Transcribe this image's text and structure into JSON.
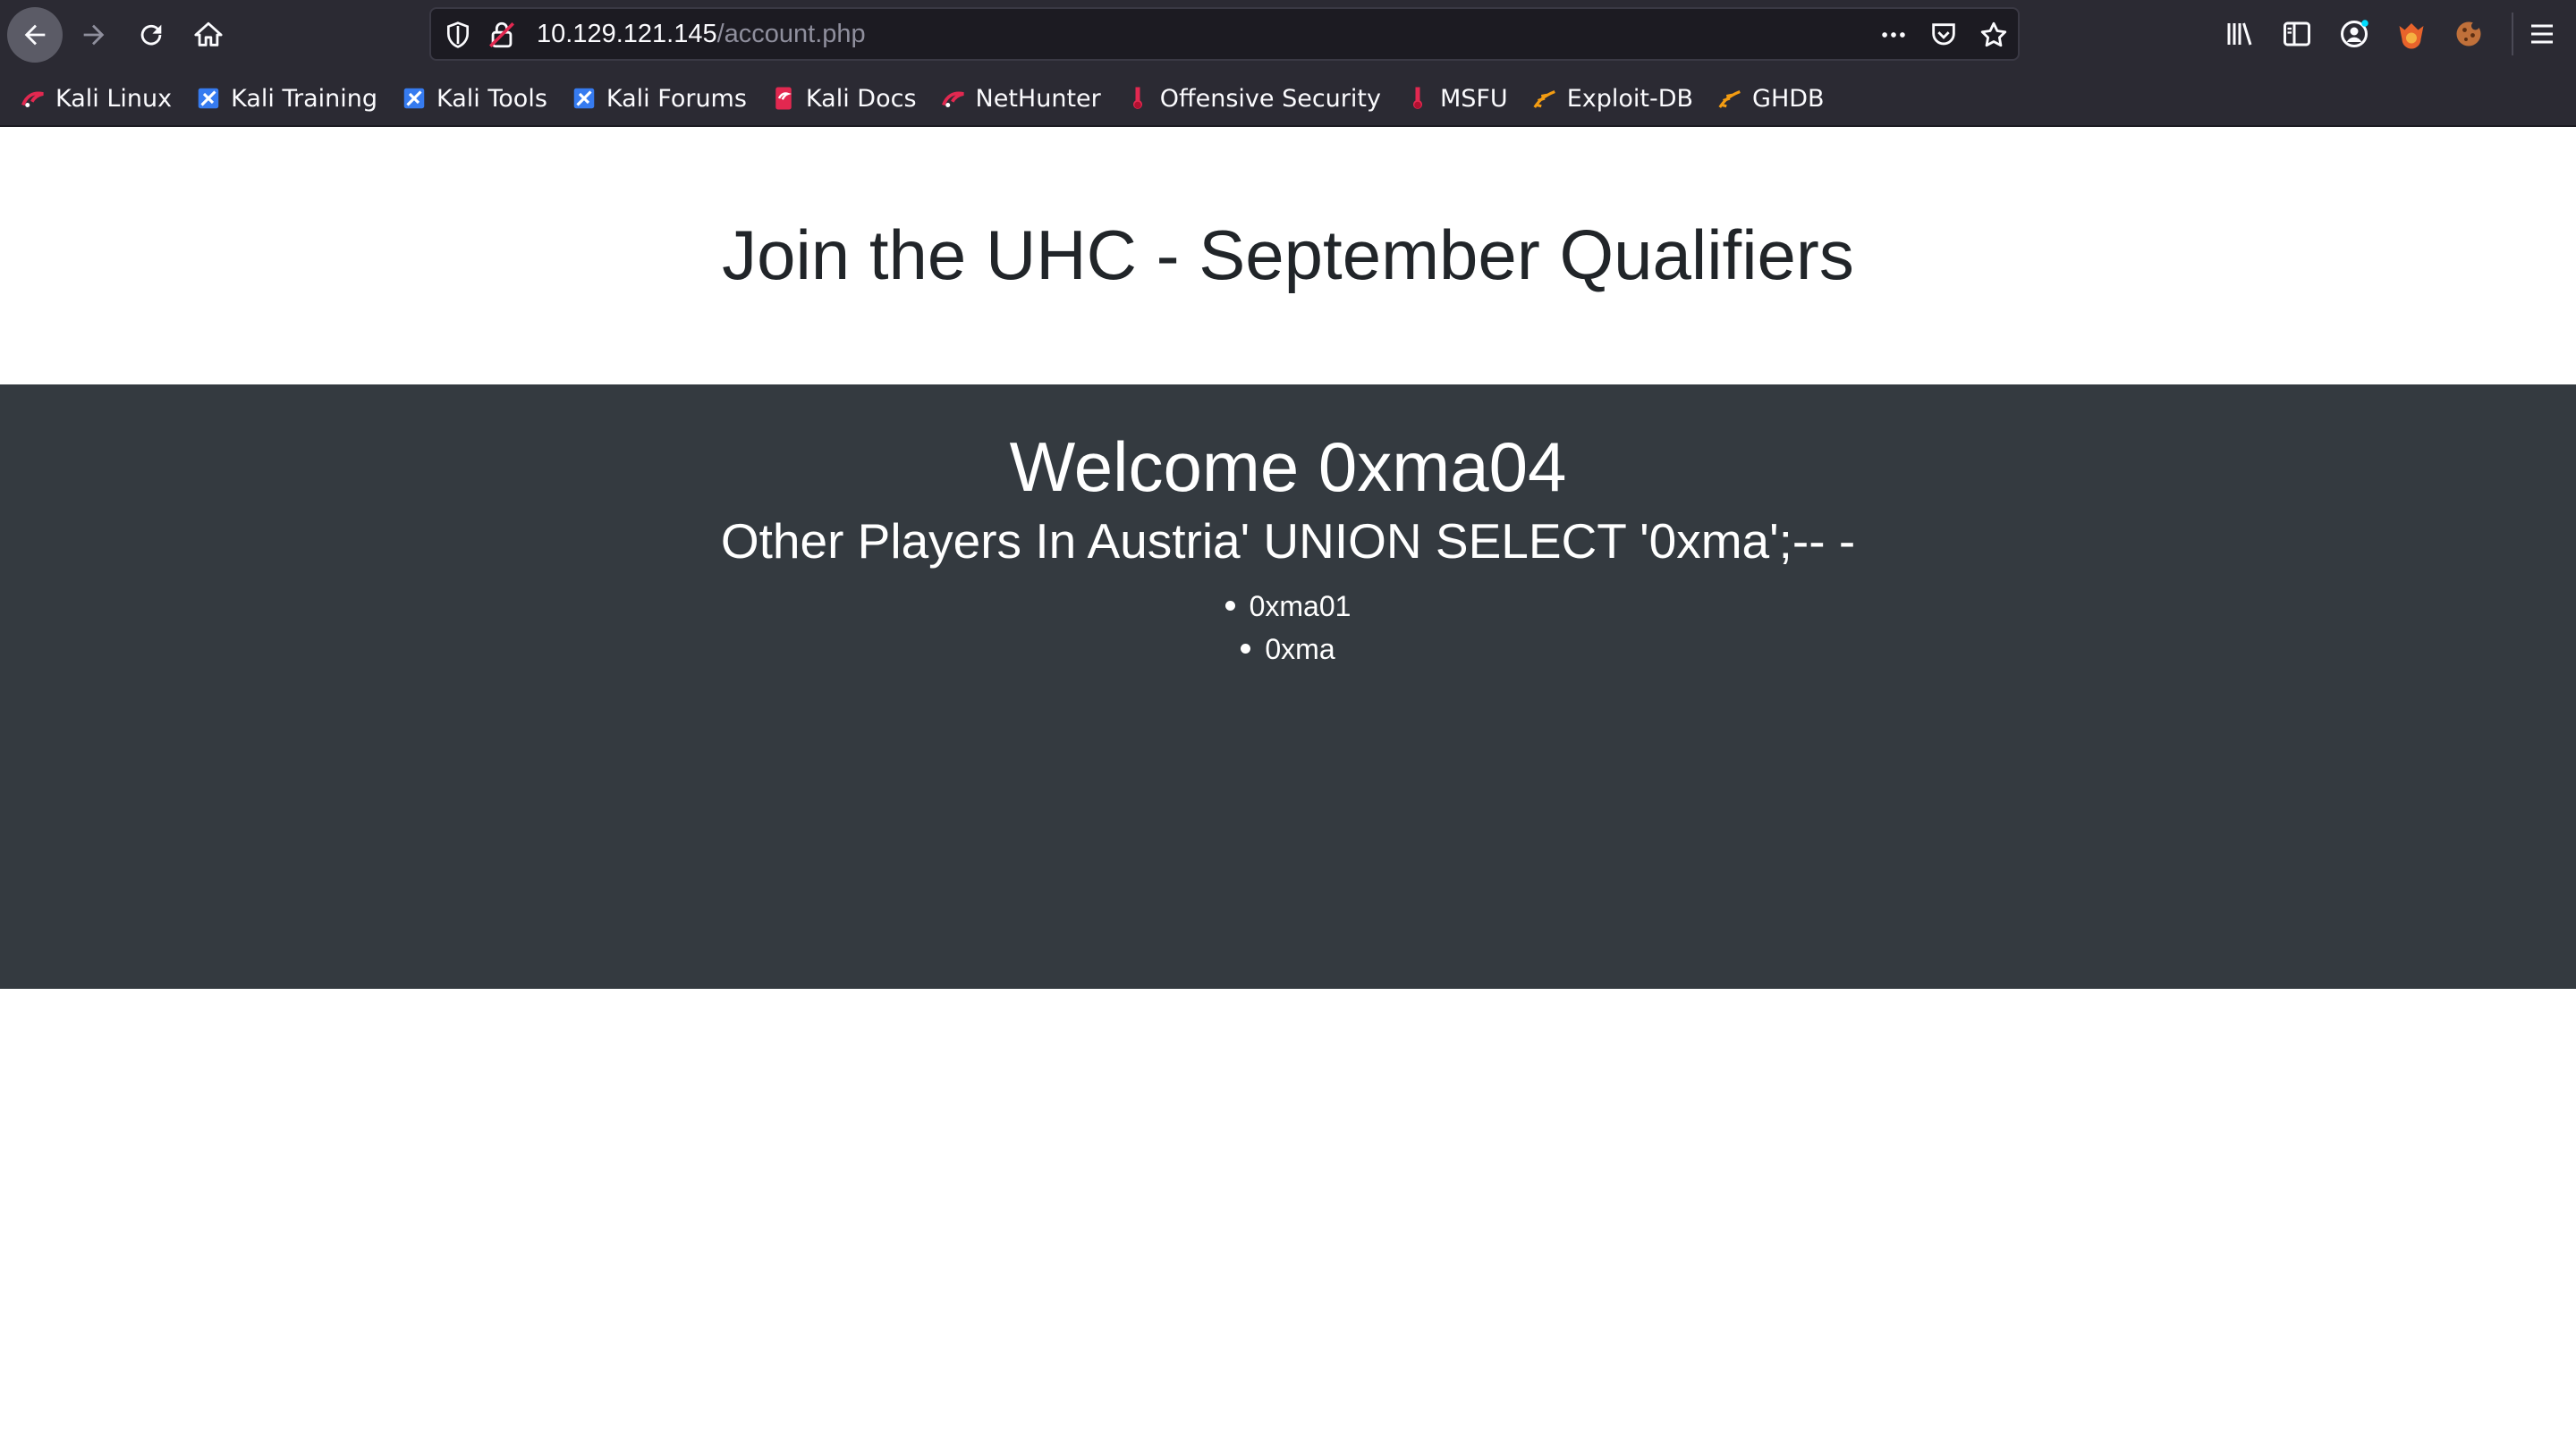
{
  "browser": {
    "url_host": "10.129.121.145",
    "url_path": "/account.php",
    "bookmarks": [
      {
        "label": "Kali Linux",
        "icon": "kali-dragon-icon"
      },
      {
        "label": "Kali Training",
        "icon": "kali-training-icon"
      },
      {
        "label": "Kali Tools",
        "icon": "kali-tools-icon"
      },
      {
        "label": "Kali Forums",
        "icon": "kali-forums-icon"
      },
      {
        "label": "Kali Docs",
        "icon": "kali-docs-icon"
      },
      {
        "label": "NetHunter",
        "icon": "nethunter-icon"
      },
      {
        "label": "Offensive Security",
        "icon": "offsec-icon"
      },
      {
        "label": "MSFU",
        "icon": "msfu-icon"
      },
      {
        "label": "Exploit-DB",
        "icon": "exploitdb-icon"
      },
      {
        "label": "GHDB",
        "icon": "ghdb-icon"
      }
    ]
  },
  "page": {
    "title": "Join the UHC - September Qualifiers",
    "welcome": "Welcome 0xma04",
    "players_heading": "Other Players In Austria' UNION SELECT '0xma';-- -",
    "players": [
      "0xma01",
      "0xma"
    ]
  },
  "colors": {
    "chrome_bg": "#2b2a33",
    "urlbar_bg": "#1c1b22",
    "dark_section": "#343a40",
    "title_text": "#212529"
  }
}
